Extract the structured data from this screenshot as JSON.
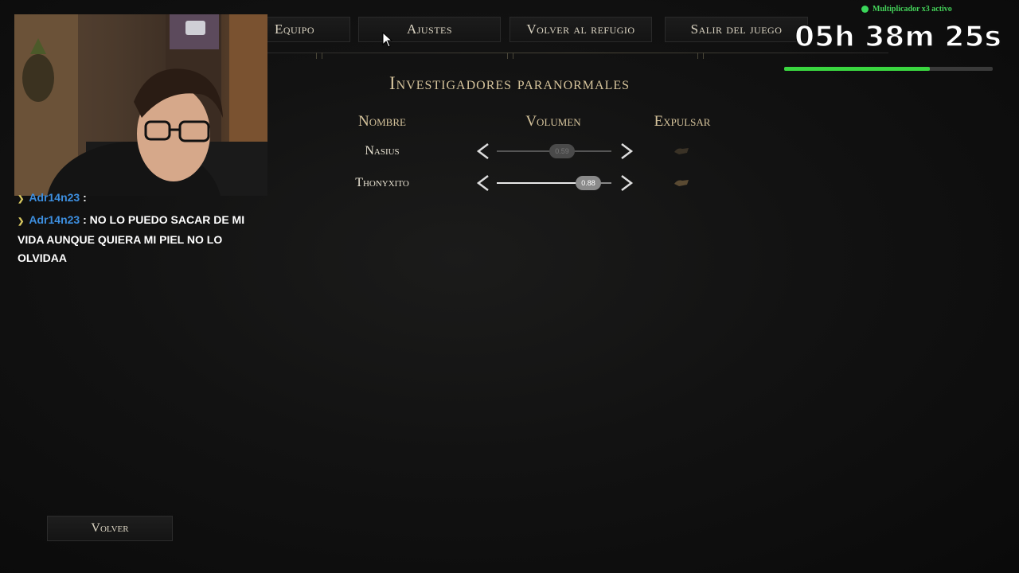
{
  "top_tabs": [
    {
      "label": "Equipo"
    },
    {
      "label": "Ajustes"
    },
    {
      "label": "Volver al refugio"
    },
    {
      "label": "Salir del juego"
    }
  ],
  "section_title": "Investigadores paranormales",
  "columns": {
    "name": "Nombre",
    "volume": "Volumen",
    "kick": "Expulsar"
  },
  "players": [
    {
      "name": "Nasius",
      "volume": "0.59",
      "volume_fraction": 0.59
    },
    {
      "name": "Thonyxito",
      "volume": "0.88",
      "volume_fraction": 0.88
    }
  ],
  "back_button": "Volver",
  "overlay": {
    "multiplier_text": "Multiplicador x3 activo",
    "timer": "05h 38m 25s",
    "progress_fraction": 0.7,
    "accent_color": "#3ad640"
  },
  "chat": [
    {
      "user": "Adr14n23",
      "message": ":"
    },
    {
      "user": "Adr14n23",
      "message": ": NO LO PUEDO SACAR DE MI VIDA AUNQUE QUIERA MI PIEL NO LO OLVIDAA"
    }
  ],
  "icons": {
    "arrow_left": "chevron-left-icon",
    "arrow_right": "chevron-right-icon",
    "kick": "kick-icon",
    "cursor": "mouse-cursor-icon"
  }
}
